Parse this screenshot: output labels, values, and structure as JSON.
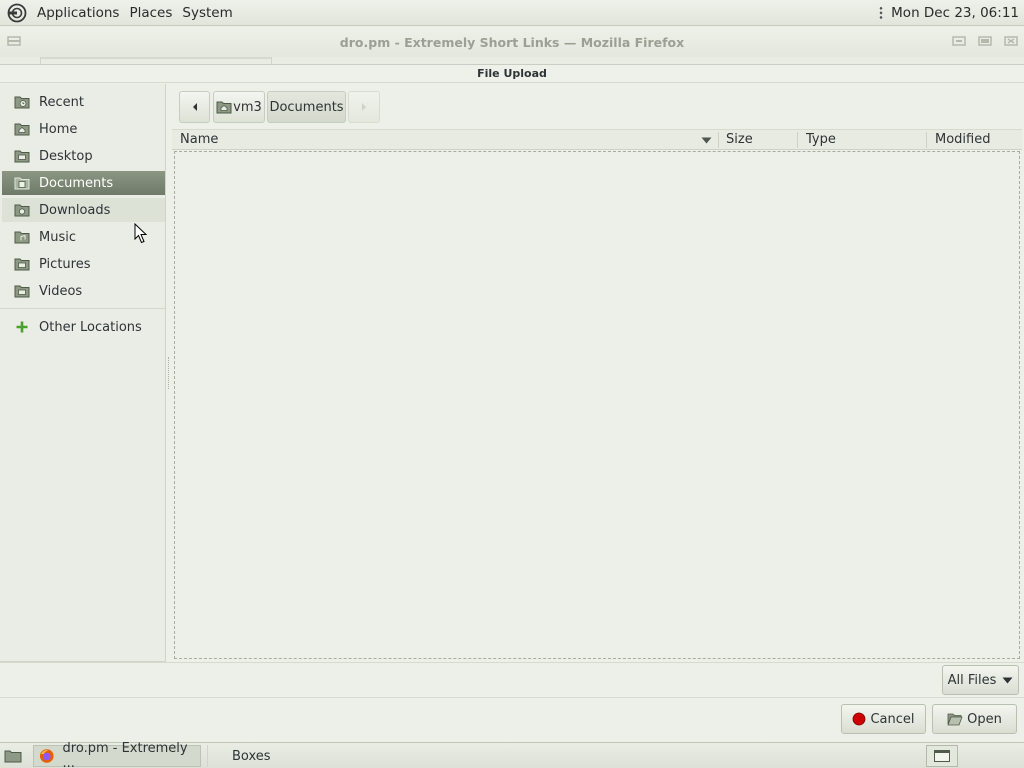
{
  "top_panel": {
    "menu": [
      "Applications",
      "Places",
      "System"
    ],
    "clock": "Mon Dec 23, 06:11"
  },
  "window": {
    "title": "dro.pm - Extremely Short Links — Mozilla Firefox"
  },
  "dialog": {
    "title": "File Upload",
    "sidebar": {
      "places": [
        {
          "label": "Recent",
          "icon": "recent-folder-icon"
        },
        {
          "label": "Home",
          "icon": "home-folder-icon"
        },
        {
          "label": "Desktop",
          "icon": "folder-icon"
        },
        {
          "label": "Documents",
          "icon": "folder-icon",
          "selected": true
        },
        {
          "label": "Downloads",
          "icon": "folder-icon",
          "hover": true
        },
        {
          "label": "Music",
          "icon": "folder-icon"
        },
        {
          "label": "Pictures",
          "icon": "folder-icon"
        },
        {
          "label": "Videos",
          "icon": "folder-icon"
        }
      ],
      "other_locations": "Other Locations"
    },
    "path_bar": {
      "segments": [
        "vm3",
        "Documents"
      ],
      "active": "Documents"
    },
    "columns": [
      "Name",
      "Size",
      "Type",
      "Modified"
    ],
    "filter": "All Files",
    "buttons": {
      "cancel": "Cancel",
      "open": "Open"
    }
  },
  "taskbar": {
    "tasks": [
      "dro.pm - Extremely ...",
      "Boxes"
    ]
  },
  "colors": {
    "selected_row": "#7a8572",
    "accent_green": "#4aa02c",
    "cancel_red": "#cc0000"
  }
}
